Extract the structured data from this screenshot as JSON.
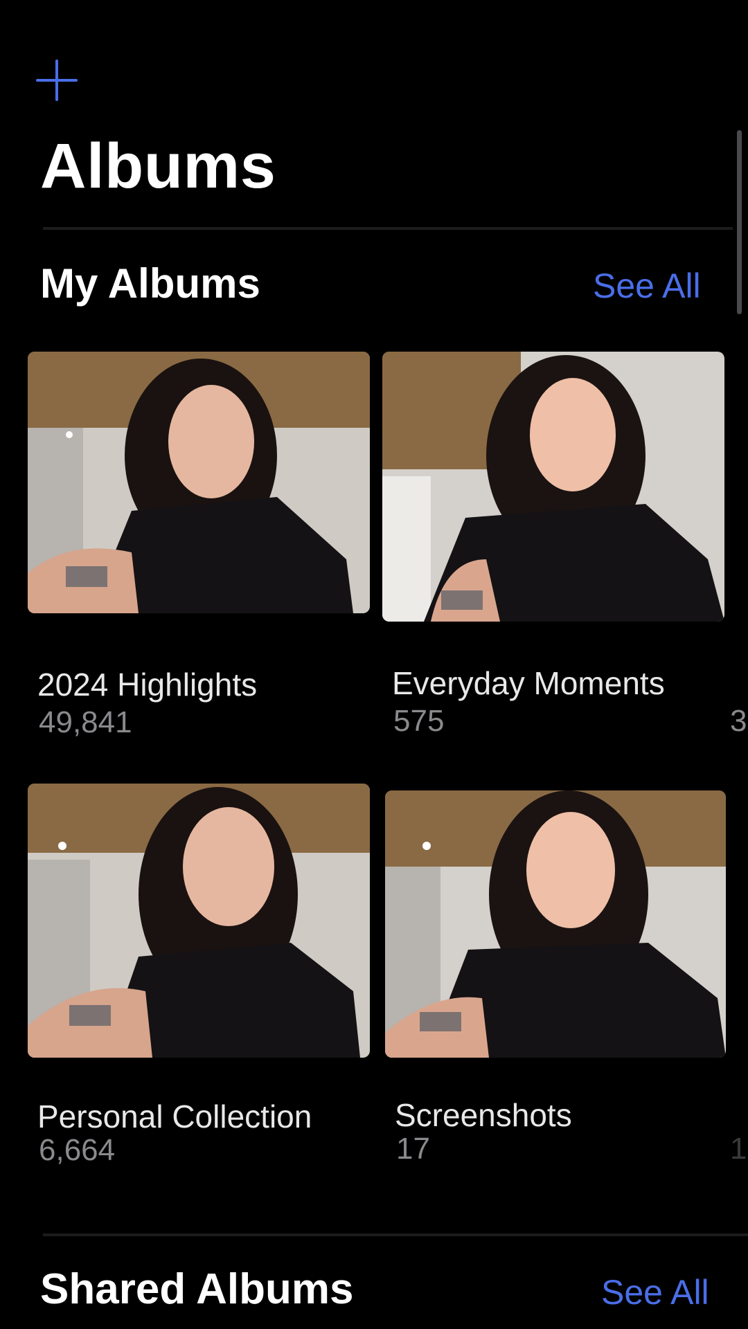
{
  "header": {
    "add_icon": "plus-icon",
    "title": "Albums"
  },
  "my_albums": {
    "section_title": "My Albums",
    "see_all_label": "See All",
    "items": [
      {
        "name": "2024 Highlights",
        "count": "49,841"
      },
      {
        "name": "Everyday Moments",
        "count": "575"
      },
      {
        "name": "Personal Collection",
        "count": "6,664"
      },
      {
        "name": "Screenshots",
        "count": "17"
      }
    ],
    "peek_count_first": "3",
    "peek_count_second": "1"
  },
  "shared_albums": {
    "section_title": "Shared Albums",
    "see_all_label": "See All"
  },
  "colors": {
    "background": "#000000",
    "accent": "#4a6ee8",
    "primary_text": "#ffffff",
    "secondary_text": "#8a8a8e"
  }
}
